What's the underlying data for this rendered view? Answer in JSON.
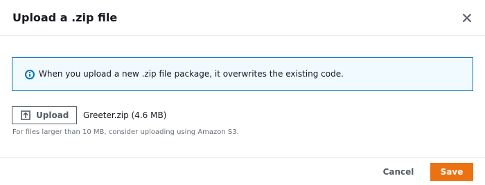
{
  "dialog": {
    "title": "Upload a .zip file",
    "close_icon": "close-icon"
  },
  "alert": {
    "type": "info",
    "icon": "info-circle-icon",
    "message": "When you upload a new .zip file package, it overwrites the existing code.",
    "border_color": "#0073bb",
    "background_color": "#f1faff"
  },
  "upload": {
    "button_label": "Upload",
    "button_icon": "upload-icon",
    "selected_file": "Greeter.zip (4.6 MB)",
    "constraint": "For files larger than 10 MB, consider uploading using Amazon S3."
  },
  "footer": {
    "cancel_label": "Cancel",
    "save_label": "Save",
    "primary_color": "#ec7211"
  }
}
